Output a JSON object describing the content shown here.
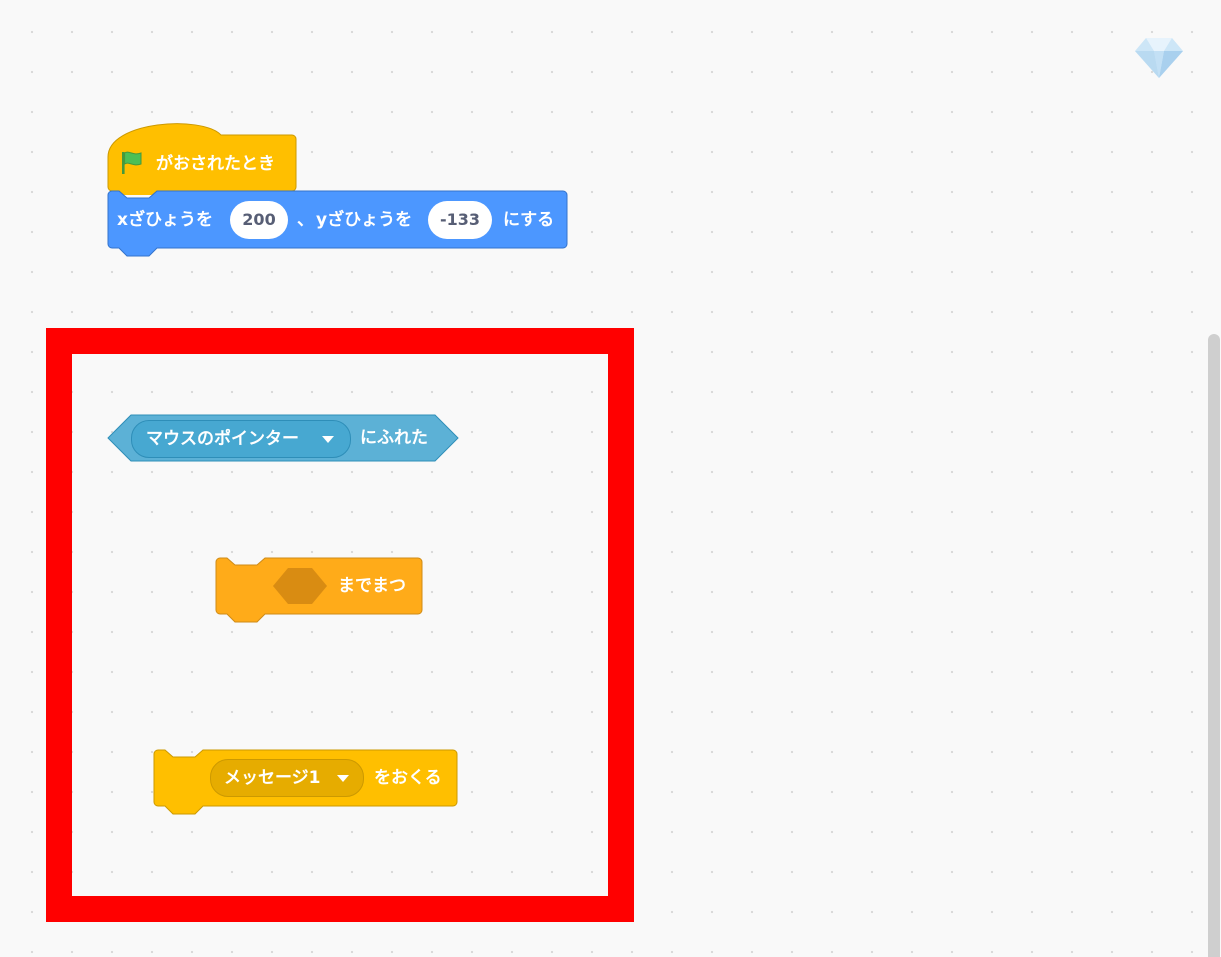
{
  "workspace": {
    "blocks": {
      "when_flag": {
        "label": "がおされたとき",
        "icon": "green-flag-icon",
        "color": "#ffbf00"
      },
      "go_to_xy": {
        "label_x": "xざひょうを",
        "x_value": "200",
        "separator": "、",
        "label_y": "yざひょうを",
        "y_value": "-133",
        "label_end": "にする",
        "color": "#4c97ff"
      },
      "touching": {
        "menu_value": "マウスのポインター",
        "label": "にふれた",
        "color": "#5cb1d6"
      },
      "wait_until": {
        "label": "までまつ",
        "color": "#ffab19"
      },
      "broadcast": {
        "menu_value": "メッセージ1",
        "label": "をおくる",
        "color": "#ffbf00"
      }
    },
    "highlight_color": "#ff0000",
    "corner_icon": "diamond-icon"
  }
}
